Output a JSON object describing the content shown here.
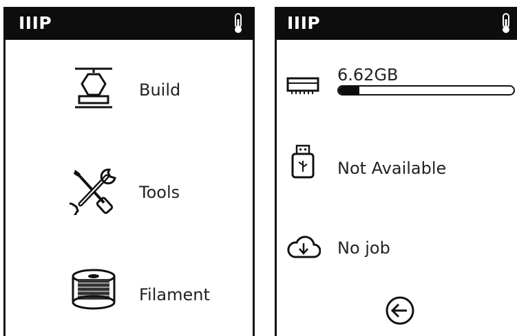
{
  "left_screen": {
    "brand": "IIIP",
    "status_icon": "thermometer-icon",
    "menu": [
      {
        "label": "Build",
        "icon": "build-plate-icon"
      },
      {
        "label": "Tools",
        "icon": "tools-icon"
      },
      {
        "label": "Filament",
        "icon": "filament-spool-icon"
      }
    ]
  },
  "right_screen": {
    "brand": "IIIP",
    "status_icon": "thermometer-icon",
    "storage": {
      "icon": "internal-storage-icon",
      "value": "6.62GB",
      "used_fraction": 0.12
    },
    "usb": {
      "icon": "usb-drive-icon",
      "status": "Not Available"
    },
    "cloud": {
      "icon": "cloud-download-icon",
      "status": "No job"
    },
    "back_icon": "back-arrow-icon"
  }
}
